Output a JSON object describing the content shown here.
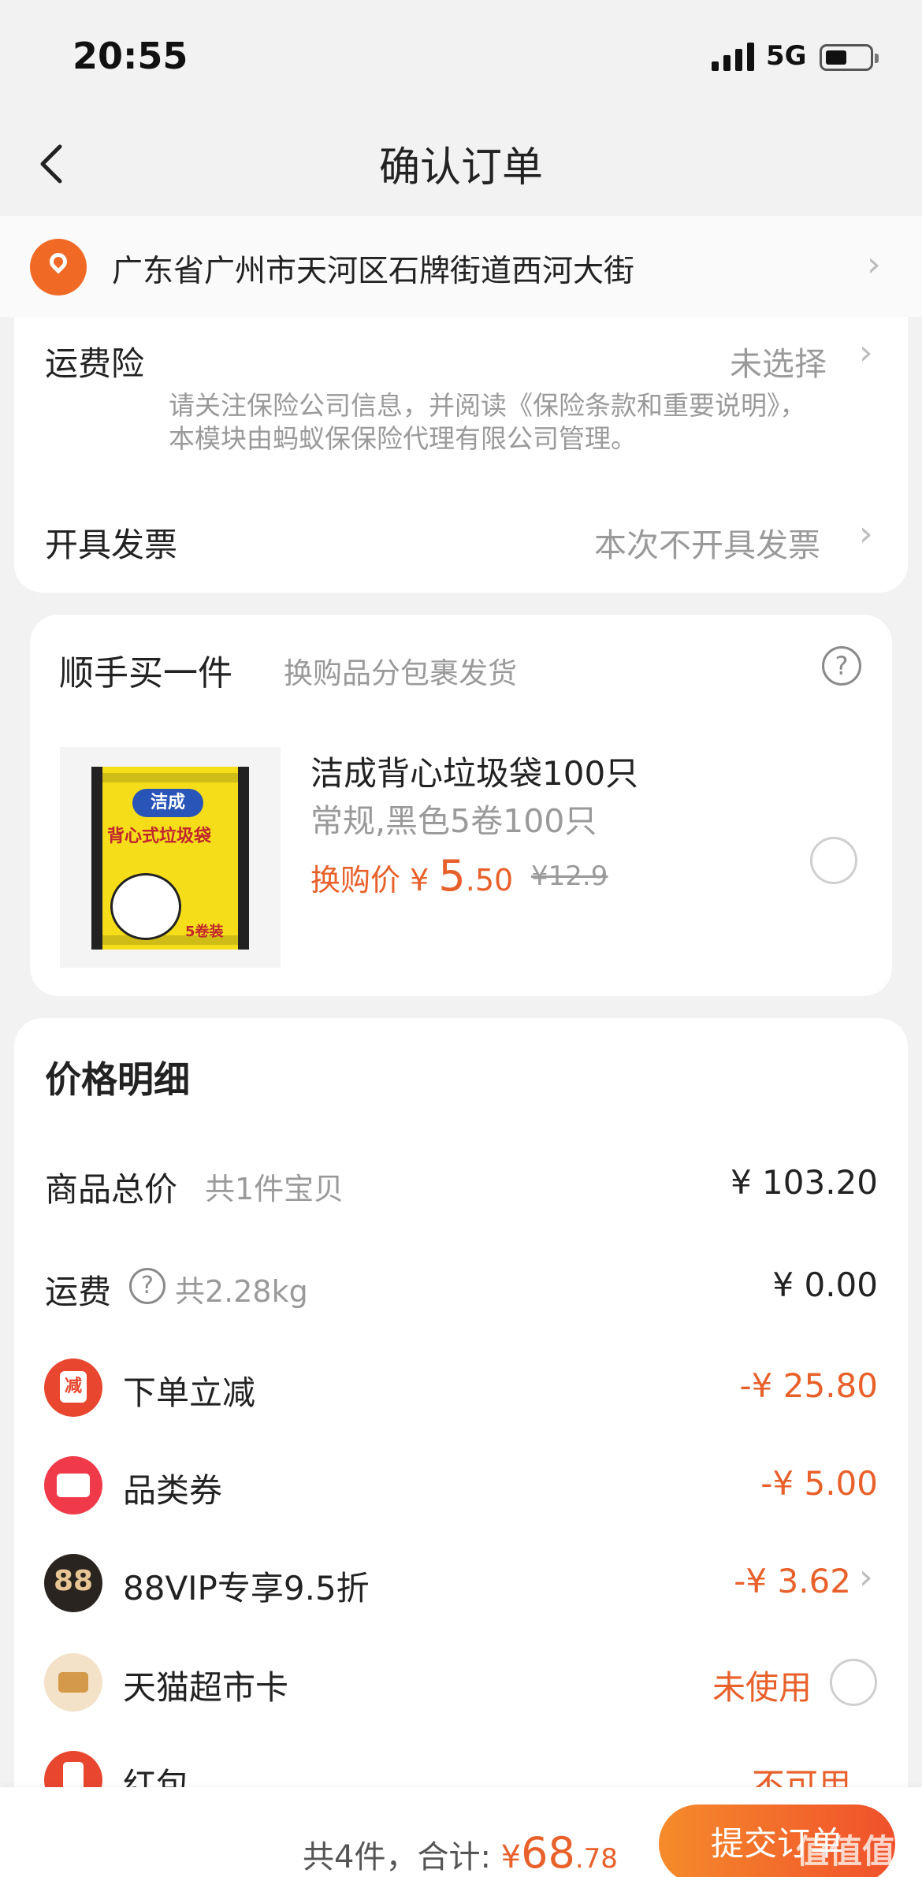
{
  "status_bar": {
    "time": "20:55",
    "network": "5G"
  },
  "nav": {
    "title": "确认订单"
  },
  "address": {
    "text": "广东省广州市天河区石牌街道西河大街"
  },
  "shipping_insurance": {
    "label": "运费险",
    "value": "未选择",
    "note": "请关注保险公司信息，并阅读《保险条款和重要说明》，本模块由蚂蚁保保险代理有限公司管理。"
  },
  "invoice": {
    "label": "开具发票",
    "value": "本次不开具发票"
  },
  "add_on": {
    "title": "顺手买一件",
    "subtitle": "换购品分包裹发货",
    "product": {
      "name": "洁成背心垃圾袋100只",
      "spec": "常规,黑色5卷100只",
      "price_label": "换购价",
      "currency": "¥",
      "price_int": "5",
      "price_dec": ".50",
      "original_price": "¥12.9",
      "image": {
        "brand": "洁成",
        "kind": "背心式垃圾袋",
        "count": "5卷装"
      }
    }
  },
  "price_detail": {
    "title": "价格明细",
    "goods_total": {
      "label": "商品总价",
      "sub": "共1件宝贝",
      "value": "¥ 103.20"
    },
    "shipping": {
      "label": "运费",
      "sub": "共2.28kg",
      "value": "¥ 0.00"
    },
    "discounts": [
      {
        "icon": "cut-icon",
        "icon_text": "减",
        "label": "下单立减",
        "value": "-¥ 25.80"
      },
      {
        "icon": "coupon-icon",
        "label": "品类券",
        "value": "-¥ 5.00"
      },
      {
        "icon": "vip-icon",
        "icon_text": "88",
        "label": "88VIP专享9.5折",
        "value": "-¥ 3.62"
      },
      {
        "icon": "card-icon",
        "label": "天猫超市卡",
        "value": "未使用"
      },
      {
        "icon": "red-packet-icon",
        "label": "红包",
        "value": "不可用"
      }
    ]
  },
  "footer": {
    "summary": "共4件，合计:",
    "currency": "¥",
    "total_int": "68",
    "total_dec": ".78",
    "submit_label": "提交订单",
    "watermark": "值值值"
  },
  "colors": {
    "accent": "#e8602a",
    "submit_start": "#f58b2b",
    "submit_end": "#f0502b",
    "pin": "#f06a25"
  }
}
